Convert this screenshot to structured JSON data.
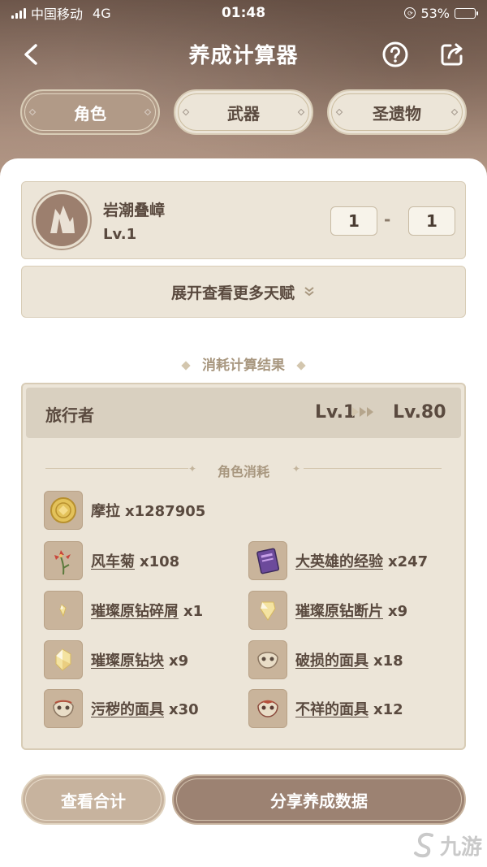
{
  "status_bar": {
    "carrier": "中国移动",
    "network": "4G",
    "time": "01:48",
    "battery_percent": "53%",
    "battery_level": 0.53
  },
  "navbar": {
    "title": "养成计算器",
    "back_icon": "chevron-left-icon",
    "help_icon": "question-circle-icon",
    "share_icon": "share-icon"
  },
  "tabs": [
    {
      "label": "角色",
      "active": true
    },
    {
      "label": "武器",
      "active": false
    },
    {
      "label": "圣遗物",
      "active": false
    }
  ],
  "character": {
    "name": "岩潮叠嶂",
    "level": "Lv.1",
    "level_from": "1",
    "level_to": "1",
    "dash": "-"
  },
  "expand": {
    "label": "展开查看更多天赋"
  },
  "result": {
    "section_title": "消耗计算结果",
    "character_name": "旅行者",
    "from_level": "Lv.1",
    "to_level": "Lv.80",
    "consumption_label": "角色消耗"
  },
  "items": [
    {
      "name": "摩拉",
      "qty": "x1287905",
      "link": false,
      "icon": "mora-coin-icon"
    },
    {
      "name": "风车菊",
      "qty": "x108",
      "link": true,
      "icon": "windwheel-aster-icon"
    },
    {
      "name": "大英雄的经验",
      "qty": "x247",
      "link": true,
      "icon": "heros-wit-book-icon"
    },
    {
      "name": "璀璨原钻碎屑",
      "qty": "x1",
      "link": true,
      "icon": "gem-sliver-icon"
    },
    {
      "name": "璀璨原钻断片",
      "qty": "x9",
      "link": true,
      "icon": "gem-fragment-icon"
    },
    {
      "name": "璀璨原钻块",
      "qty": "x9",
      "link": true,
      "icon": "gem-chunk-icon"
    },
    {
      "name": "破损的面具",
      "qty": "x18",
      "link": true,
      "icon": "damaged-mask-icon"
    },
    {
      "name": "污秽的面具",
      "qty": "x30",
      "link": true,
      "icon": "stained-mask-icon"
    },
    {
      "name": "不祥的面具",
      "qty": "x12",
      "link": true,
      "icon": "ominous-mask-icon"
    }
  ],
  "buttons": {
    "total": "查看合计",
    "share": "分享养成数据"
  },
  "watermark": {
    "text": "九游"
  },
  "colors": {
    "accent_brown": "#9c8272",
    "card_bg": "#ece5d8",
    "text_dark": "#5a4a3f",
    "muted": "#a8977f"
  }
}
